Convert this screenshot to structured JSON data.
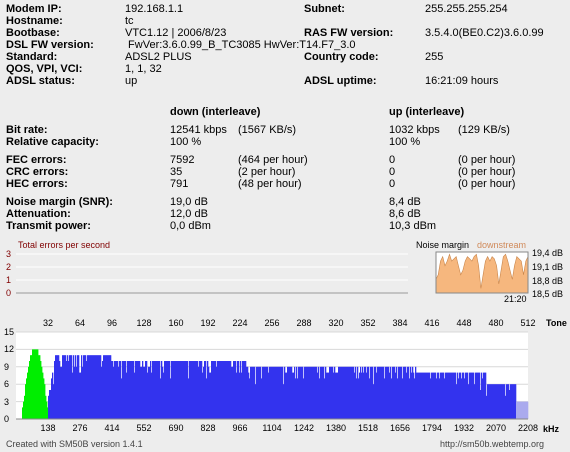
{
  "info": {
    "modem_ip_label": "Modem IP:",
    "modem_ip": "192.168.1.1",
    "subnet_label": "Subnet:",
    "subnet": "255.255.255.254",
    "hostname_label": "Hostname:",
    "hostname": "tc",
    "bootbase_label": "Bootbase:",
    "bootbase": "VTC1.12 | 2006/8/23",
    "ras_fw_label": "RAS FW version:",
    "ras_fw": "3.5.4.0(BE0.C2)3.6.0.99",
    "dsl_fw_label": "DSL FW version:",
    "dsl_fw": " FwVer:3.6.0.99_B_TC3085 HwVer:T14.F7_3.0",
    "standard_label": "Standard:",
    "standard": "ADSL2 PLUS",
    "country_label": "Country code:",
    "country": "255",
    "qos_label": "QOS, VPI, VCI:",
    "qos": "1, 1, 32",
    "adsl_status_label": "ADSL status:",
    "adsl_status": "up",
    "uptime_label": "ADSL uptime:",
    "uptime": "16:21:09 hours"
  },
  "stats": {
    "down_header": "down (interleave)",
    "up_header": "up (interleave)",
    "rows": [
      {
        "label": "Bit rate:",
        "down": "12541 kbps",
        "down_extra": "(1567 KB/s)",
        "up": "1032 kbps",
        "up_extra": "(129 KB/s)"
      },
      {
        "label": "Relative capacity:",
        "down": "100 %",
        "down_extra": "",
        "up": "100 %",
        "up_extra": ""
      },
      {
        "label": "FEC errors:",
        "down": "7592",
        "down_extra": "(464 per hour)",
        "up": "0",
        "up_extra": "(0 per hour)"
      },
      {
        "label": "CRC errors:",
        "down": "35",
        "down_extra": "(2 per hour)",
        "up": "0",
        "up_extra": "(0 per hour)"
      },
      {
        "label": "HEC errors:",
        "down": "791",
        "down_extra": "(48 per hour)",
        "up": "0",
        "up_extra": "(0 per hour)"
      },
      {
        "label": "Noise margin (SNR):",
        "down": "19,0 dB",
        "down_extra": "",
        "up": "8,4 dB",
        "up_extra": ""
      },
      {
        "label": "Attenuation:",
        "down": "12,0 dB",
        "down_extra": "",
        "up": "8,6 dB",
        "up_extra": ""
      },
      {
        "label": "Transmit power:",
        "down": "0,0 dBm",
        "down_extra": "",
        "up": "10,3 dBm",
        "up_extra": ""
      }
    ]
  },
  "colors": {
    "background": "#ededed",
    "upstream_bins": "#00ee00",
    "downstream_bins": "#3333ee",
    "noise_fill": "#f6b77e",
    "errors_title": "#800000",
    "downstream_legend": "#d08a5a"
  },
  "chart_data": [
    {
      "type": "line",
      "title": "Total errors per second",
      "ylim": [
        0,
        3
      ],
      "y_ticks": [
        "3",
        "2",
        "1",
        "0"
      ],
      "series": [],
      "grid": true
    },
    {
      "type": "area",
      "title": "Noise margin",
      "series": [
        {
          "name": "downstream"
        }
      ],
      "y_ticks": [
        "19,4 dB",
        "19,1 dB",
        "18,8 dB",
        "18,5 dB"
      ],
      "ylim": [
        18.5,
        19.4
      ],
      "x_end_label": "21:20",
      "values": [
        18.8,
        18.9,
        19.2,
        19.3,
        19.1,
        19.2,
        19.35,
        19.2,
        19.25,
        19.3,
        19.1,
        18.9,
        19.0,
        19.2,
        19.3,
        19.25,
        19.2,
        19.3,
        19.35,
        19.1,
        18.6,
        18.9,
        19.2,
        19.3,
        19.2,
        19.3,
        19.25,
        19.1,
        18.7,
        19.0,
        19.3,
        19.35,
        19.2,
        19.0,
        18.8,
        19.1,
        19.3,
        19.25,
        19.2,
        18.9,
        19.2,
        19.3
      ]
    },
    {
      "type": "bar",
      "title": "",
      "xlabel": "kHz",
      "x2label": "Tone",
      "ylim": [
        0,
        15
      ],
      "y_ticks": [
        "15",
        "12",
        "9",
        "6",
        "3",
        "0"
      ],
      "tone_ticks": [
        "32",
        "64",
        "96",
        "128",
        "160",
        "192",
        "224",
        "256",
        "288",
        "320",
        "352",
        "384",
        "416",
        "448",
        "480",
        "512"
      ],
      "khz_ticks": [
        "138",
        "276",
        "414",
        "552",
        "690",
        "828",
        "966",
        "1104",
        "1242",
        "1380",
        "1518",
        "1656",
        "1794",
        "1932",
        "2070",
        "2208"
      ],
      "series": [
        {
          "name": "upstream",
          "tone_range": [
            6,
            31
          ],
          "max_bits": 12
        },
        {
          "name": "downstream",
          "tone_range": [
            32,
            511
          ],
          "max_bits": 11
        }
      ]
    }
  ],
  "status": {
    "left": "Created with SM50B version 1.4.1",
    "right": "http://sm50b.webtemp.org"
  }
}
